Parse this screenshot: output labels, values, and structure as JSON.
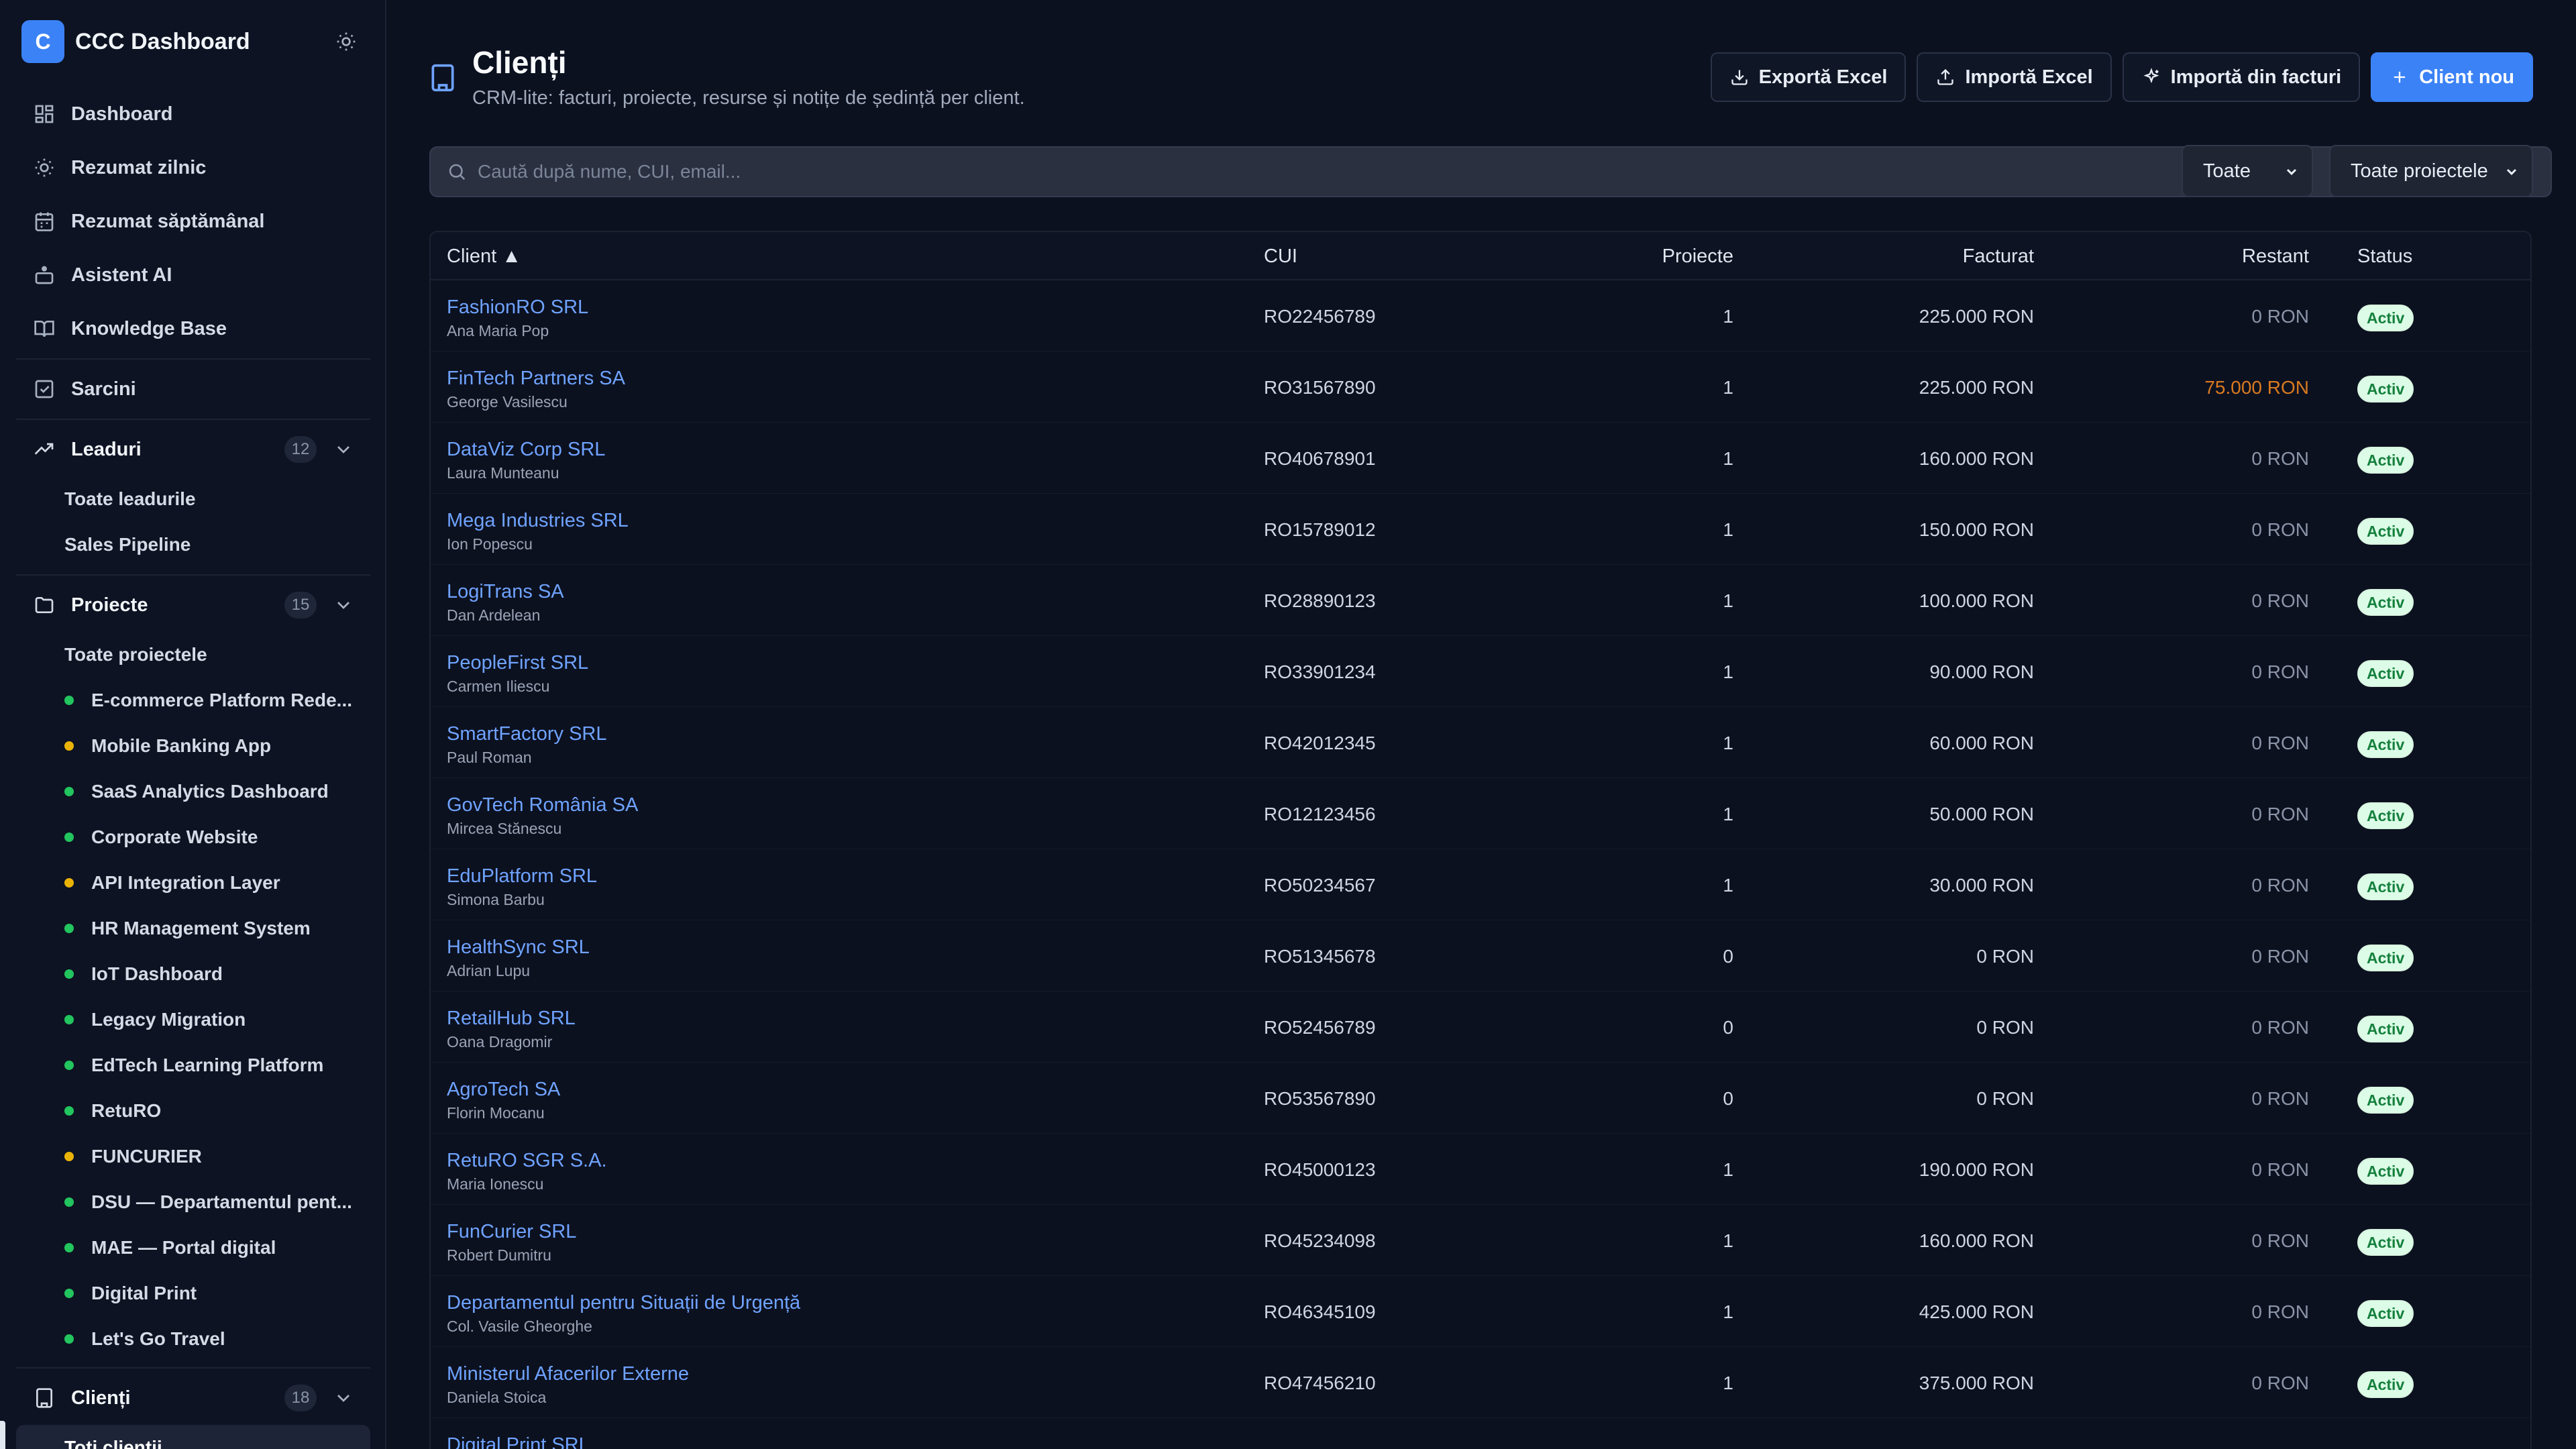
{
  "app": {
    "logo_letter": "C",
    "name": "CCC Dashboard"
  },
  "nav": {
    "items": [
      {
        "label": "Dashboard",
        "icon": "grid-icon"
      },
      {
        "label": "Rezumat zilnic",
        "icon": "sun-icon"
      },
      {
        "label": "Rezumat săptămânal",
        "icon": "calendar-icon"
      },
      {
        "label": "Asistent AI",
        "icon": "bot-icon"
      },
      {
        "label": "Knowledge Base",
        "icon": "book-icon"
      }
    ],
    "sarcini": "Sarcini",
    "leaduri": {
      "label": "Leaduri",
      "count": "12",
      "subs": [
        "Toate leadurile",
        "Sales Pipeline"
      ]
    },
    "proiecte": {
      "label": "Proiecte",
      "count": "15",
      "all": "Toate proiectele",
      "items": [
        {
          "label": "E-commerce Platform Rede...",
          "color": "#22c55e"
        },
        {
          "label": "Mobile Banking App",
          "color": "#eab308"
        },
        {
          "label": "SaaS Analytics Dashboard",
          "color": "#22c55e"
        },
        {
          "label": "Corporate Website",
          "color": "#22c55e"
        },
        {
          "label": "API Integration Layer",
          "color": "#eab308"
        },
        {
          "label": "HR Management System",
          "color": "#22c55e"
        },
        {
          "label": "IoT Dashboard",
          "color": "#22c55e"
        },
        {
          "label": "Legacy Migration",
          "color": "#22c55e"
        },
        {
          "label": "EdTech Learning Platform",
          "color": "#22c55e"
        },
        {
          "label": "RetuRO",
          "color": "#22c55e"
        },
        {
          "label": "FUNCURIER",
          "color": "#eab308"
        },
        {
          "label": "DSU — Departamentul pent...",
          "color": "#22c55e"
        },
        {
          "label": "MAE — Portal digital",
          "color": "#22c55e"
        },
        {
          "label": "Digital Print",
          "color": "#22c55e"
        },
        {
          "label": "Let's Go Travel",
          "color": "#22c55e"
        }
      ]
    },
    "clienti": {
      "label": "Clienți",
      "count": "18",
      "subs": [
        "Toți clienții"
      ]
    }
  },
  "page": {
    "title": "Clienți",
    "subtitle": "CRM-lite: facturi, proiecte, resurse și notițe de ședință per client."
  },
  "actions": {
    "export": "Exportă Excel",
    "import": "Importă Excel",
    "import_invoices": "Importă din facturi",
    "new_client": "Client nou"
  },
  "filters": {
    "search_placeholder": "Caută după nume, CUI, email...",
    "status": "Toate",
    "projects": "Toate proiectele"
  },
  "table": {
    "headers": {
      "client": "Client ▲",
      "cui": "CUI",
      "projects": "Proiecte",
      "invoiced": "Facturat",
      "overdue": "Restant",
      "status": "Status"
    },
    "rows": [
      {
        "name": "FashionRO SRL",
        "contact": "Ana Maria Pop",
        "cui": "RO22456789",
        "projects": "1",
        "invoiced": "225.000 RON",
        "overdue": "0 RON",
        "overdue_flag": false,
        "status": "Activ"
      },
      {
        "name": "FinTech Partners SA",
        "contact": "George Vasilescu",
        "cui": "RO31567890",
        "projects": "1",
        "invoiced": "225.000 RON",
        "overdue": "75.000 RON",
        "overdue_flag": true,
        "status": "Activ"
      },
      {
        "name": "DataViz Corp SRL",
        "contact": "Laura Munteanu",
        "cui": "RO40678901",
        "projects": "1",
        "invoiced": "160.000 RON",
        "overdue": "0 RON",
        "overdue_flag": false,
        "status": "Activ"
      },
      {
        "name": "Mega Industries SRL",
        "contact": "Ion Popescu",
        "cui": "RO15789012",
        "projects": "1",
        "invoiced": "150.000 RON",
        "overdue": "0 RON",
        "overdue_flag": false,
        "status": "Activ"
      },
      {
        "name": "LogiTrans SA",
        "contact": "Dan Ardelean",
        "cui": "RO28890123",
        "projects": "1",
        "invoiced": "100.000 RON",
        "overdue": "0 RON",
        "overdue_flag": false,
        "status": "Activ"
      },
      {
        "name": "PeopleFirst SRL",
        "contact": "Carmen Iliescu",
        "cui": "RO33901234",
        "projects": "1",
        "invoiced": "90.000 RON",
        "overdue": "0 RON",
        "overdue_flag": false,
        "status": "Activ"
      },
      {
        "name": "SmartFactory SRL",
        "contact": "Paul Roman",
        "cui": "RO42012345",
        "projects": "1",
        "invoiced": "60.000 RON",
        "overdue": "0 RON",
        "overdue_flag": false,
        "status": "Activ"
      },
      {
        "name": "GovTech România SA",
        "contact": "Mircea Stănescu",
        "cui": "RO12123456",
        "projects": "1",
        "invoiced": "50.000 RON",
        "overdue": "0 RON",
        "overdue_flag": false,
        "status": "Activ"
      },
      {
        "name": "EduPlatform SRL",
        "contact": "Simona Barbu",
        "cui": "RO50234567",
        "projects": "1",
        "invoiced": "30.000 RON",
        "overdue": "0 RON",
        "overdue_flag": false,
        "status": "Activ"
      },
      {
        "name": "HealthSync SRL",
        "contact": "Adrian Lupu",
        "cui": "RO51345678",
        "projects": "0",
        "invoiced": "0 RON",
        "overdue": "0 RON",
        "overdue_flag": false,
        "status": "Activ"
      },
      {
        "name": "RetailHub SRL",
        "contact": "Oana Dragomir",
        "cui": "RO52456789",
        "projects": "0",
        "invoiced": "0 RON",
        "overdue": "0 RON",
        "overdue_flag": false,
        "status": "Activ"
      },
      {
        "name": "AgroTech SA",
        "contact": "Florin Mocanu",
        "cui": "RO53567890",
        "projects": "0",
        "invoiced": "0 RON",
        "overdue": "0 RON",
        "overdue_flag": false,
        "status": "Activ"
      },
      {
        "name": "RetuRO SGR S.A.",
        "contact": "Maria Ionescu",
        "cui": "RO45000123",
        "projects": "1",
        "invoiced": "190.000 RON",
        "overdue": "0 RON",
        "overdue_flag": false,
        "status": "Activ"
      },
      {
        "name": "FunCurier SRL",
        "contact": "Robert Dumitru",
        "cui": "RO45234098",
        "projects": "1",
        "invoiced": "160.000 RON",
        "overdue": "0 RON",
        "overdue_flag": false,
        "status": "Activ"
      },
      {
        "name": "Departamentul pentru Situații de Urgență",
        "contact": "Col. Vasile Gheorghe",
        "cui": "RO46345109",
        "projects": "1",
        "invoiced": "425.000 RON",
        "overdue": "0 RON",
        "overdue_flag": false,
        "status": "Activ"
      },
      {
        "name": "Ministerul Afacerilor Externe",
        "contact": "Daniela Stoica",
        "cui": "RO47456210",
        "projects": "1",
        "invoiced": "375.000 RON",
        "overdue": "0 RON",
        "overdue_flag": false,
        "status": "Activ"
      },
      {
        "name": "Digital Print SRL",
        "contact": "",
        "cui": "",
        "projects": "",
        "invoiced": "",
        "overdue": "",
        "overdue_flag": false,
        "status": ""
      }
    ]
  }
}
